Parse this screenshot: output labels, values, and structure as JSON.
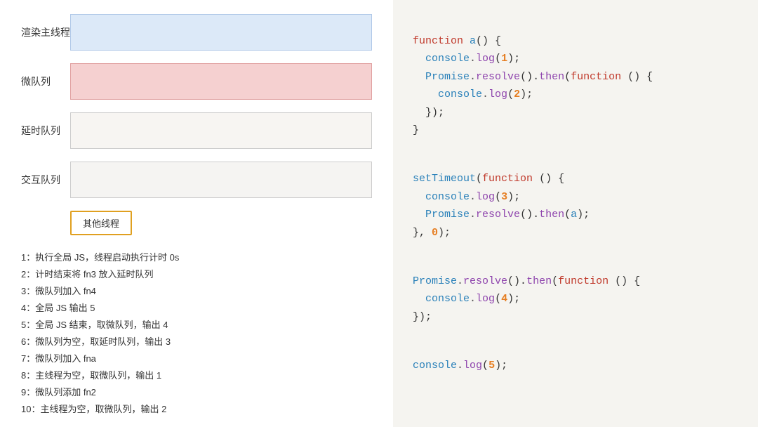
{
  "left": {
    "queues": [
      {
        "label": "渲染主线程",
        "type": "main-thread"
      },
      {
        "label": "微队列",
        "type": "microtask"
      },
      {
        "label": "延时队列",
        "type": "delay-queue"
      },
      {
        "label": "交互队列",
        "type": "interact-queue"
      }
    ],
    "other_thread_label": "其他线程",
    "steps": [
      "1：执行全局 JS，线程启动执行计时 0s",
      "2：计时结束将 fn3 放入延时队列",
      "3：微队列加入 fn4",
      "4：全局 JS 输出 5",
      "5：全局 JS 结束，取微队列，输出 4",
      "6：微队列为空，取延时队列，输出 3",
      "7：微队列加入 fna",
      "8：主线程为空，取微队列，输出 1",
      "9：微队列添加 fn2",
      "10：主线程为空，取微队列，输出 2"
    ]
  },
  "right": {
    "title": "code-view"
  }
}
